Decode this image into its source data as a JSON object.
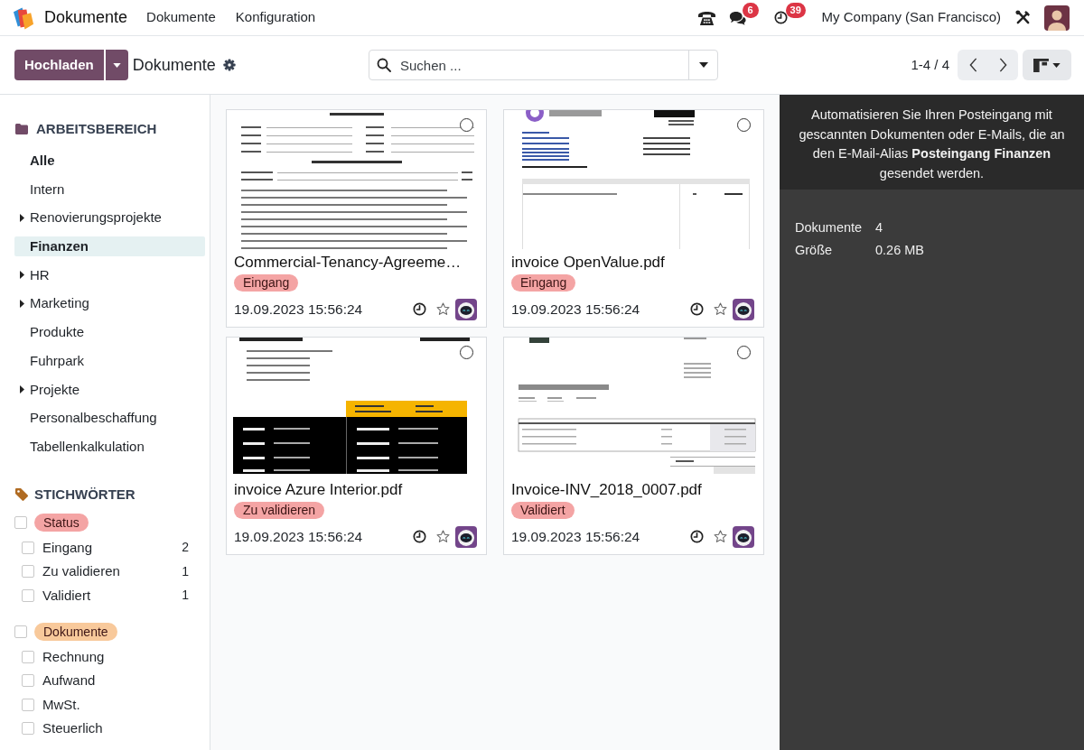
{
  "navbar": {
    "app_name": "Dokumente",
    "menu": [
      "Dokumente",
      "Konfiguration"
    ],
    "messages_badge": "6",
    "activities_badge": "39",
    "company": "My Company (San Francisco)"
  },
  "control_panel": {
    "upload_button": "Hochladen",
    "breadcrumb": "Dokumente",
    "search": {
      "placeholder": "Suchen ..."
    },
    "pager": "1-4 / 4"
  },
  "sidebar": {
    "workspace_heading": "ARBEITSBEREICH",
    "folders": [
      {
        "label": "Alle",
        "has_children": false,
        "selected": false,
        "bold": true
      },
      {
        "label": "Intern",
        "has_children": false,
        "selected": false,
        "bold": false
      },
      {
        "label": "Renovierungsprojekte",
        "has_children": true,
        "selected": false,
        "bold": false
      },
      {
        "label": "Finanzen",
        "has_children": false,
        "selected": true,
        "bold": true
      },
      {
        "label": "HR",
        "has_children": true,
        "selected": false,
        "bold": false
      },
      {
        "label": "Marketing",
        "has_children": true,
        "selected": false,
        "bold": false
      },
      {
        "label": "Produkte",
        "has_children": false,
        "selected": false,
        "bold": false
      },
      {
        "label": "Fuhrpark",
        "has_children": false,
        "selected": false,
        "bold": false
      },
      {
        "label": "Projekte",
        "has_children": true,
        "selected": false,
        "bold": false
      },
      {
        "label": "Personalbeschaffung",
        "has_children": false,
        "selected": false,
        "bold": false
      },
      {
        "label": "Tabellenkalkulation",
        "has_children": false,
        "selected": false,
        "bold": false
      }
    ],
    "tags_heading": "STICHWÖRTER",
    "tag_groups": [
      {
        "label": "Status",
        "color": "#f4a4a4",
        "checked": false,
        "children": [
          {
            "label": "Eingang",
            "count": "2",
            "checked": false
          },
          {
            "label": "Zu validieren",
            "count": "1",
            "checked": false
          },
          {
            "label": "Validiert",
            "count": "1",
            "checked": false
          }
        ]
      },
      {
        "label": "Dokumente",
        "color": "#f8c99b",
        "checked": false,
        "children": [
          {
            "label": "Rechnung",
            "checked": false
          },
          {
            "label": "Aufwand",
            "checked": false
          },
          {
            "label": "MwSt.",
            "checked": false
          },
          {
            "label": "Steuerlich",
            "checked": false
          }
        ]
      }
    ]
  },
  "cards": [
    {
      "title": "Commercial-Tenancy-Agreeme…",
      "tag": {
        "label": "Eingang",
        "color": "#f4a4a4"
      },
      "date": "19.09.2023 15:56:24",
      "selected": false,
      "favorite": false,
      "thumbnail": {
        "kind": "text"
      }
    },
    {
      "title": "invoice OpenValue.pdf",
      "tag": {
        "label": "Eingang",
        "color": "#f4a4a4"
      },
      "date": "19.09.2023 15:56:24",
      "selected": false,
      "favorite": false,
      "thumbnail": {
        "kind": "invoice"
      }
    },
    {
      "title": "invoice Azure Interior.pdf",
      "tag": {
        "label": "Zu validieren",
        "color": "#f4a4a4"
      },
      "date": "19.09.2023 15:56:24",
      "selected": false,
      "favorite": false,
      "thumbnail": {
        "kind": "banner"
      }
    },
    {
      "title": "Invoice-INV_2018_0007.pdf",
      "tag": {
        "label": "Validiert",
        "color": "#f4a4a4"
      },
      "date": "19.09.2023 15:56:24",
      "selected": false,
      "favorite": false,
      "thumbnail": {
        "kind": "table"
      }
    }
  ],
  "details": {
    "message": "Automatisieren Sie Ihren Posteingang mit gescannten Dokumenten oder E-Mails, die an den E-Mail-Alias **Posteingang Finanzen** gesendet werden.",
    "stats": [
      {
        "label": "Dokumente",
        "value": "4"
      },
      {
        "label": "Größe",
        "value": "0.26 MB"
      }
    ]
  }
}
